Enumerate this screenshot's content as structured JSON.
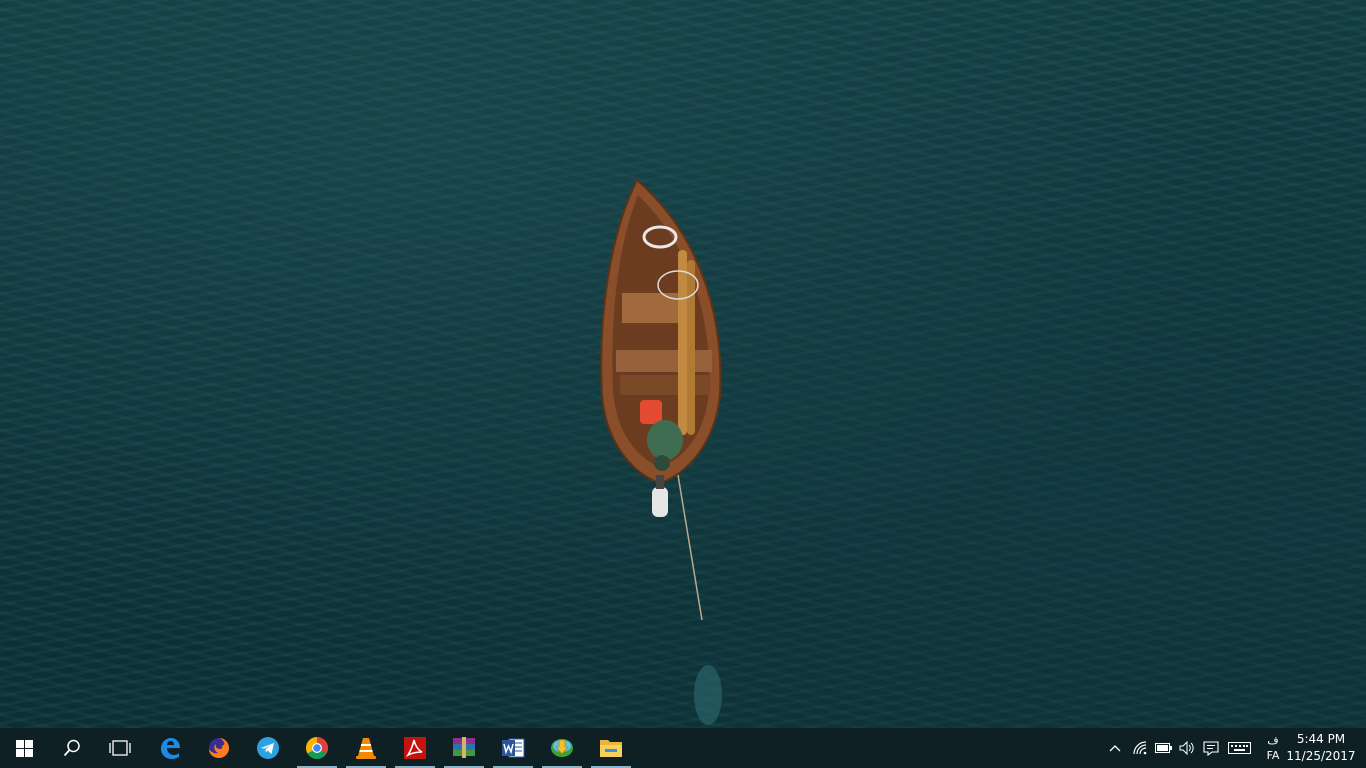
{
  "desktop": {
    "wallpaper": "aerial-boat-on-water",
    "water_color": "#10383e"
  },
  "taskbar": {
    "background": "#0f2024",
    "pinned": [
      {
        "name": "start",
        "icon": "windows-logo-icon",
        "running": false
      },
      {
        "name": "search",
        "icon": "search-icon",
        "running": false
      },
      {
        "name": "task-view",
        "icon": "task-view-icon",
        "running": false
      },
      {
        "name": "edge",
        "icon": "edge-icon",
        "running": false
      },
      {
        "name": "firefox",
        "icon": "firefox-icon",
        "running": false
      },
      {
        "name": "telegram",
        "icon": "telegram-icon",
        "running": false
      },
      {
        "name": "chrome",
        "icon": "chrome-icon",
        "running": true
      },
      {
        "name": "vlc",
        "icon": "vlc-icon",
        "running": true
      },
      {
        "name": "acrobat",
        "icon": "acrobat-icon",
        "running": true
      },
      {
        "name": "winrar",
        "icon": "winrar-icon",
        "running": true
      },
      {
        "name": "word",
        "icon": "word-icon",
        "running": true
      },
      {
        "name": "download-manager",
        "icon": "download-manager-icon",
        "running": true
      },
      {
        "name": "file-explorer",
        "icon": "folder-icon",
        "running": true
      }
    ],
    "tray": {
      "icons": [
        "chevron-up-icon",
        "wifi-icon",
        "battery-icon",
        "volume-icon",
        "notification-icon",
        "keyboard-icon"
      ],
      "language_top": "ف",
      "language_code": "FA",
      "time": "5:44 PM",
      "date": "11/25/2017"
    }
  }
}
